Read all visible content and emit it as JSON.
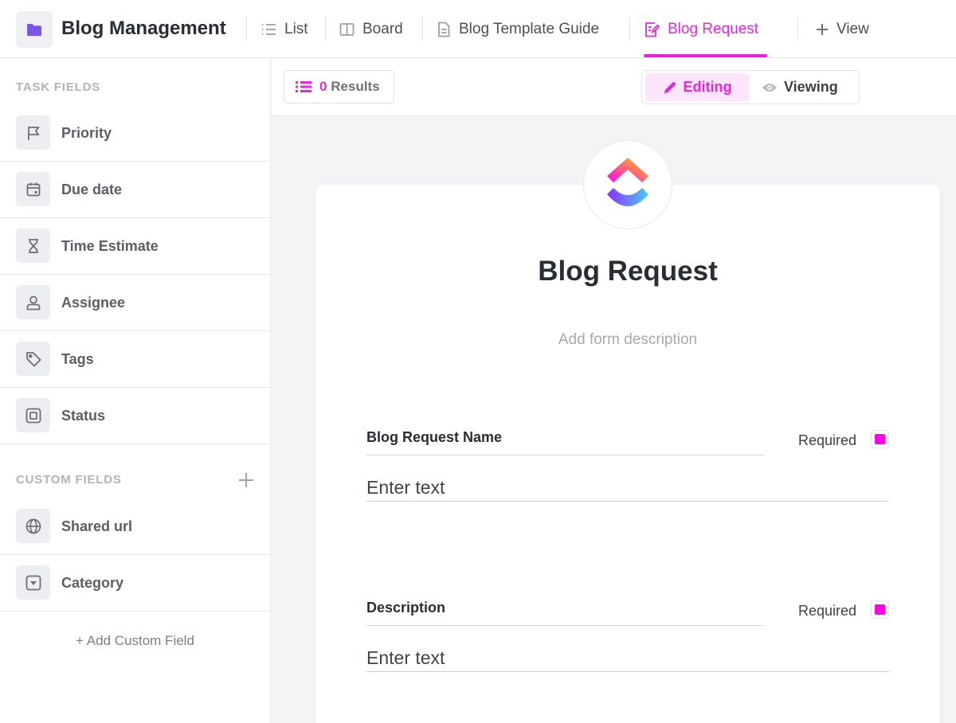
{
  "header": {
    "space_title": "Blog Management",
    "tabs": [
      {
        "label": "List",
        "icon": "list-icon"
      },
      {
        "label": "Board",
        "icon": "board-icon"
      },
      {
        "label": "Blog Template Guide",
        "icon": "doc-icon"
      },
      {
        "label": "Blog Request",
        "icon": "form-icon",
        "active": true
      },
      {
        "label": "View",
        "icon": "plus-icon"
      }
    ]
  },
  "sidebar": {
    "task_fields_heading": "TASK FIELDS",
    "task_fields": [
      {
        "label": "Priority",
        "icon": "flag-icon"
      },
      {
        "label": "Due date",
        "icon": "calendar-icon"
      },
      {
        "label": "Time Estimate",
        "icon": "hourglass-icon"
      },
      {
        "label": "Assignee",
        "icon": "user-icon"
      },
      {
        "label": "Tags",
        "icon": "tag-icon"
      },
      {
        "label": "Status",
        "icon": "status-icon"
      }
    ],
    "custom_fields_heading": "CUSTOM FIELDS",
    "custom_fields": [
      {
        "label": "Shared url",
        "icon": "globe-icon"
      },
      {
        "label": "Category",
        "icon": "dropdown-icon"
      }
    ],
    "add_custom_field": "+ Add Custom Field"
  },
  "toolbar": {
    "results_count": "0",
    "results_label": "Results",
    "editing_label": "Editing",
    "viewing_label": "Viewing"
  },
  "form": {
    "title": "Blog Request",
    "description_placeholder": "Add form description",
    "questions": [
      {
        "label": "Blog Request Name",
        "required_label": "Required",
        "required": true,
        "placeholder": "Enter text"
      },
      {
        "label": "Description",
        "required_label": "Required",
        "required": true,
        "placeholder": "Enter text"
      }
    ]
  },
  "colors": {
    "accent": "#e02bd8",
    "space_icon": "#7b55e6"
  }
}
